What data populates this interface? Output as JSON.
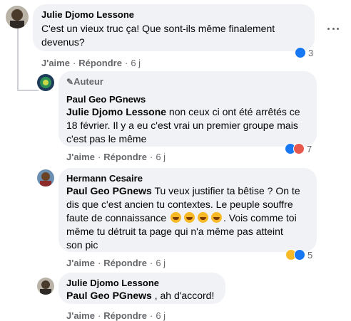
{
  "comments": [
    {
      "author": "Julie Djomo Lessone",
      "lines": [
        "C'est un vieux truc ça! Que sont-ils même finalement",
        "devenus?"
      ],
      "actions": {
        "like": "J'aime",
        "reply": "Répondre",
        "time": "6 j"
      },
      "reaction_count": "3"
    },
    {
      "badge": "Auteur",
      "author": "Paul Geo PGnews",
      "mention": "Julie Djomo Lessone",
      "lines": [
        " non ceux ci ont été arrêtés ce",
        "18 février. Il y a eu c'est vrai un premier groupe mais",
        "c'est pas le même"
      ],
      "actions": {
        "like": "J'aime",
        "reply": "Répondre",
        "time": "6 j"
      },
      "reaction_count": "7"
    },
    {
      "author": "Hermann Cesaire",
      "mention": "Paul Geo PGnews",
      "lines": [
        " Tu veux justifier ta bêtise ? On te",
        "dis que c'est ancien tu contextes. Le peuple souffre",
        "faute de connaissance",
        ". Vois comme toi",
        "même tu détruit ta page qui n'a même pas atteint",
        "son pic"
      ],
      "actions": {
        "like": "J'aime",
        "reply": "Répondre",
        "time": "6 j"
      },
      "reaction_count": "5"
    },
    {
      "author": "Julie Djomo Lessone",
      "mention": "Paul Geo PGnews",
      "lines": [
        " , ah d'accord!"
      ],
      "actions": {
        "like": "J'aime",
        "reply": "Répondre",
        "time": "6 j"
      }
    }
  ],
  "more_icon": "more-horizontal-icon",
  "colors": {
    "bubble": "#f0f2f5",
    "like": "#1877f2",
    "haha": "#f7b928",
    "angry": "#e8584d"
  }
}
